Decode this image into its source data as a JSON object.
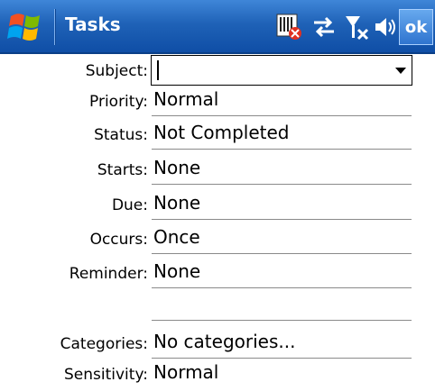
{
  "titlebar": {
    "title": "Tasks",
    "ok_label": "ok",
    "icons": [
      "windows-start-icon",
      "no-sim-icon",
      "connectivity-icon",
      "no-signal-icon",
      "volume-icon"
    ]
  },
  "form": {
    "subject": {
      "label": "Subject:",
      "value": ""
    },
    "priority": {
      "label": "Priority:",
      "value": "Normal"
    },
    "status": {
      "label": "Status:",
      "value": "Not Completed"
    },
    "starts": {
      "label": "Starts:",
      "value": "None"
    },
    "due": {
      "label": "Due:",
      "value": "None"
    },
    "occurs": {
      "label": "Occurs:",
      "value": "Once"
    },
    "reminder": {
      "label": "Reminder:",
      "value": "None"
    },
    "categories": {
      "label": "Categories:",
      "value": "No categories..."
    },
    "sensitivity": {
      "label": "Sensitivity:",
      "value": "Normal"
    }
  }
}
